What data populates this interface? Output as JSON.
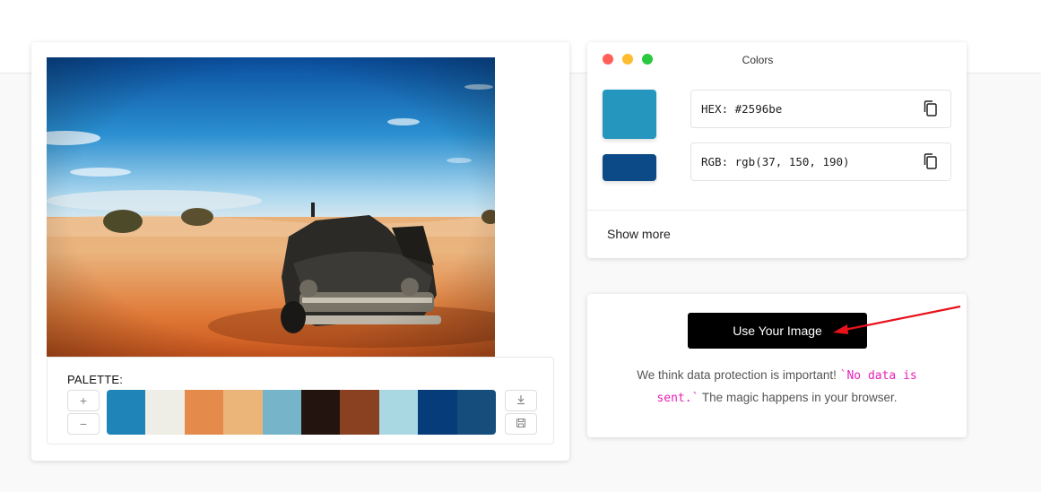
{
  "palette": {
    "title": "PALETTE:",
    "add_label": "+",
    "remove_label": "−",
    "swatches": [
      "#1f85b8",
      "#eeeee6",
      "#e48a4a",
      "#ebb57a",
      "#76b4c9",
      "#231410",
      "#8a4122",
      "#a9d8e2",
      "#073c7a",
      "#154d7d"
    ]
  },
  "colors_window": {
    "title": "Colors",
    "dot_colors": [
      "#ff5f57",
      "#febc2e",
      "#28c840"
    ],
    "primary_swatch": "#2596be",
    "secondary_swatch": "#0c4a87",
    "hex_label": "HEX: #2596be",
    "rgb_label": "RGB: rgb(37, 150, 190)",
    "show_more": "Show more"
  },
  "cta": {
    "button_label": "Use Your Image",
    "note_before": "We think data protection is important! ",
    "note_code": "`No data is sent.`",
    "note_after": " The magic happens in your browser."
  },
  "annotation": {
    "arrow_color": "#e8121b"
  }
}
